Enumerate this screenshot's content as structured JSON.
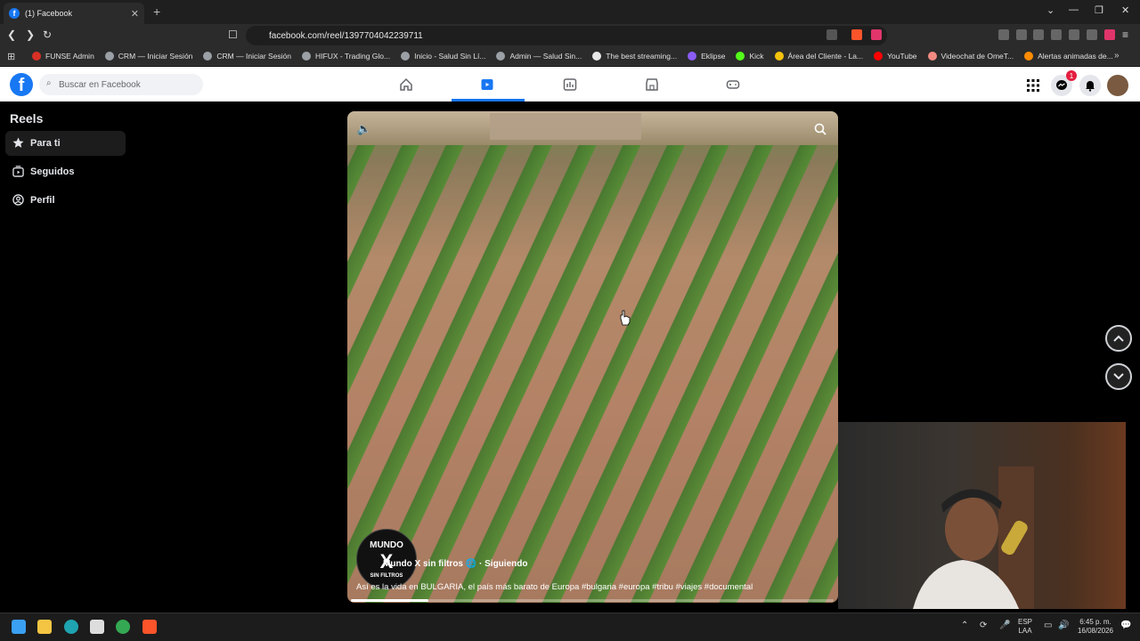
{
  "browser": {
    "tab_title": "(1) Facebook",
    "url": "facebook.com/reel/1397704042239711",
    "bookmarks": [
      {
        "label": "FUNSE Admin",
        "color": "#d93025"
      },
      {
        "label": "CRM — Iniciar Sesión",
        "color": "#9aa0a6"
      },
      {
        "label": "CRM — Iniciar Sesión",
        "color": "#9aa0a6"
      },
      {
        "label": "HIFUX - Trading Glo...",
        "color": "#9aa0a6"
      },
      {
        "label": "Inicio - Salud Sin Lí...",
        "color": "#9aa0a6"
      },
      {
        "label": "Admin — Salud Sin...",
        "color": "#9aa0a6"
      },
      {
        "label": "The best streaming...",
        "color": "#e8e8e8"
      },
      {
        "label": "Eklipse",
        "color": "#8b5cf6"
      },
      {
        "label": "Kick",
        "color": "#53fc18"
      },
      {
        "label": "Área del Cliente - La...",
        "color": "#f4c20d"
      },
      {
        "label": "YouTube",
        "color": "#ff0000"
      },
      {
        "label": "Videochat de OmeT...",
        "color": "#f28b82"
      },
      {
        "label": "Alertas animadas de...",
        "color": "#ff8c00"
      }
    ]
  },
  "facebook": {
    "search_placeholder": "Buscar en Facebook",
    "notification_count": "1",
    "accent": "#1877f2"
  },
  "sidebar": {
    "title": "Reels",
    "items": [
      {
        "label": "Para ti",
        "icon": "star-icon"
      },
      {
        "label": "Seguidos",
        "icon": "follow-icon"
      },
      {
        "label": "Perfil",
        "icon": "profile-icon"
      }
    ]
  },
  "reel": {
    "channel_avatar_top": "MUNDO",
    "channel_avatar_mid": "X",
    "channel_avatar_bottom": "SIN FILTROS",
    "channel_name": "Mundo X sin filtros",
    "follow_status": "· Siguiendo",
    "caption": "Así es la vida en BULGARIA, el país más barato de Europa #bulgaria #europa #tribu #viajes #documental",
    "progress_fraction": 0.16
  },
  "taskbar": {
    "lang_top": "ESP",
    "lang_bottom": "LAA",
    "time": "6:45 p. m.",
    "date": "16/08/2026"
  }
}
